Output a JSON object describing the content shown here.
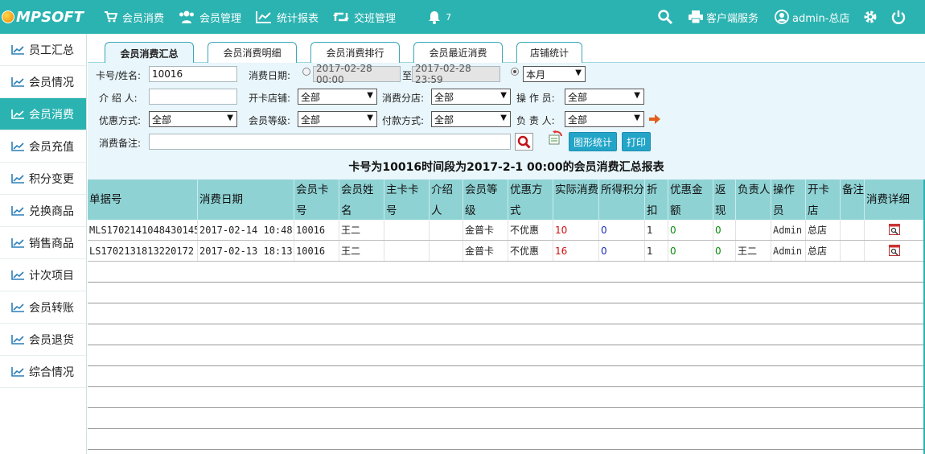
{
  "app": {
    "logo_text": "MPSOFT"
  },
  "topnav": {
    "items": [
      {
        "label": "会员消费",
        "icon": "cart-icon"
      },
      {
        "label": "会员管理",
        "icon": "users-icon"
      },
      {
        "label": "统计报表",
        "icon": "chart-line-icon"
      },
      {
        "label": "交班管理",
        "icon": "retweet-icon"
      },
      {
        "label": "7",
        "icon": "bell-icon"
      }
    ],
    "client_service": "客户端服务",
    "user": "admin-总店"
  },
  "sidebar": {
    "items": [
      {
        "label": "员工汇总"
      },
      {
        "label": "会员情况"
      },
      {
        "label": "会员消费"
      },
      {
        "label": "会员充值"
      },
      {
        "label": "积分变更"
      },
      {
        "label": "兑换商品"
      },
      {
        "label": "销售商品"
      },
      {
        "label": "计次项目"
      },
      {
        "label": "会员转账"
      },
      {
        "label": "会员退货"
      },
      {
        "label": "综合情况"
      }
    ],
    "active": "会员消费"
  },
  "tabs": [
    {
      "label": "会员消费汇总"
    },
    {
      "label": "会员消费明细"
    },
    {
      "label": "会员消费排行"
    },
    {
      "label": "会员最近消费"
    },
    {
      "label": "店铺统计"
    }
  ],
  "filter": {
    "card_label": "卡号/姓名:",
    "card_value": "10016",
    "date_label": "消费日期:",
    "date_from": "2017-02-28 00:00",
    "date_to_sep": "至",
    "date_to": "2017-02-28 23:59",
    "period_value": "本月",
    "referrer_label": "介 绍 人:",
    "referrer_value": "",
    "open_store_label": "开卡店铺:",
    "open_store_value": "全部",
    "consume_branch_label": "消费分店:",
    "consume_branch_value": "全部",
    "operator_label": "操 作 员:",
    "operator_value": "全部",
    "discount_label": "优惠方式:",
    "discount_value": "全部",
    "level_label": "会员等级:",
    "level_value": "全部",
    "payment_label": "付款方式:",
    "payment_value": "全部",
    "manager_label": "负 责 人:",
    "manager_value": "全部",
    "remark_label": "消费备注:",
    "remark_value": "",
    "chart_button": "图形统计",
    "print_button": "打印"
  },
  "report": {
    "title": "卡号为10016时间段为2017-2-1 00:00的会员消费汇总报表",
    "columns": [
      "单据号",
      "消费日期",
      "会员卡号",
      "会员姓名",
      "主卡卡号",
      "介绍人",
      "会员等级",
      "优惠方式",
      "实际消费",
      "所得积分",
      "折扣",
      "优惠金额",
      "返现",
      "负责人",
      "操作员",
      "开卡店",
      "备注",
      "消费详细"
    ],
    "rows": [
      {
        "no": "MLS1702141048430145",
        "date": "2017-02-14 10:48",
        "card": "10016",
        "name": "王二",
        "main_card": "",
        "referrer": "",
        "level": "金普卡",
        "discount_mode": "不优惠",
        "actual": "10",
        "points": "0",
        "discount": "1",
        "discount_amount": "0",
        "cashback": "0",
        "manager": "",
        "operator": "Admin",
        "store": "总店",
        "remark": ""
      },
      {
        "no": "LS1702131813220172",
        "date": "2017-02-13 18:13",
        "card": "10016",
        "name": "王二",
        "main_card": "",
        "referrer": "",
        "level": "金普卡",
        "discount_mode": "不优惠",
        "actual": "16",
        "points": "0",
        "discount": "1",
        "discount_amount": "0",
        "cashback": "0",
        "manager": "王二",
        "operator": "Admin",
        "store": "总店",
        "remark": ""
      }
    ]
  },
  "colors": {
    "brand": "#2bb3b1",
    "header": "#8fd2d4",
    "button": "#23a5c8"
  }
}
